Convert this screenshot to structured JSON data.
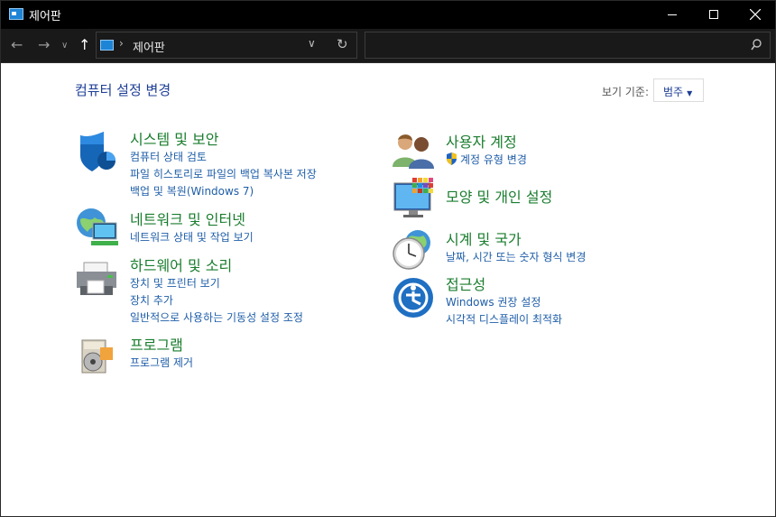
{
  "window": {
    "title": "제어판"
  },
  "address": {
    "path": "제어판",
    "search_placeholder": ""
  },
  "heading": "컴퓨터 설정 변경",
  "view_by": {
    "label": "보기 기준:",
    "value": "범주"
  },
  "categories_left": [
    {
      "title": "시스템 및 보안",
      "icon": "shield-icon",
      "links": [
        "컴퓨터 상태 검토",
        "파일 히스토리로 파일의 백업 복사본 저장",
        "백업 및 복원(Windows 7)"
      ]
    },
    {
      "title": "네트워크 및 인터넷",
      "icon": "network-globe-icon",
      "links": [
        "네트워크 상태 및 작업 보기"
      ]
    },
    {
      "title": "하드웨어 및 소리",
      "icon": "printer-icon",
      "links": [
        "장치 및 프린터 보기",
        "장치 추가",
        "일반적으로 사용하는 기동성 설정 조정"
      ]
    },
    {
      "title": "프로그램",
      "icon": "programs-disc-icon",
      "links": [
        "프로그램 제거"
      ]
    }
  ],
  "categories_right": [
    {
      "title": "사용자 계정",
      "icon": "users-icon",
      "links": [
        "계정 유형 변경"
      ]
    },
    {
      "title": "모양 및 개인 설정",
      "icon": "monitor-palette-icon",
      "links": []
    },
    {
      "title": "시계 및 국가",
      "icon": "clock-globe-icon",
      "links": [
        "날짜, 시간 또는 숫자 형식 변경"
      ]
    },
    {
      "title": "접근성",
      "icon": "accessibility-icon",
      "links": [
        "Windows 권장 설정",
        "시각적 디스플레이 최적화"
      ]
    }
  ],
  "colors": {
    "title_bar": "#000000",
    "category_title": "#1a7d2e",
    "link": "#1f5ea8",
    "heading": "#1e3f96"
  }
}
